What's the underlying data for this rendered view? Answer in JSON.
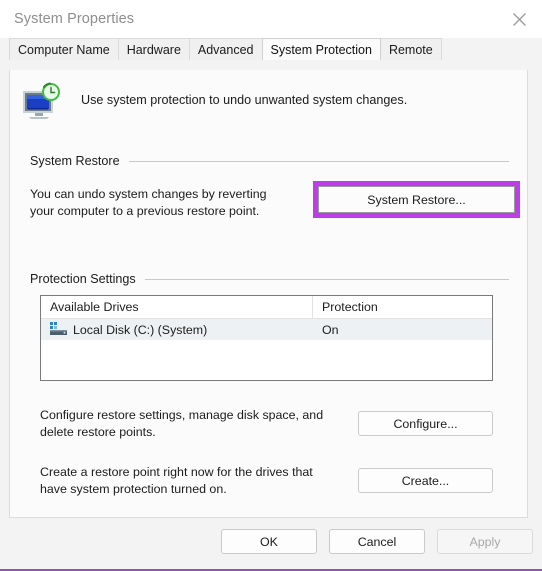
{
  "window": {
    "title": "System Properties",
    "close_icon": "close-icon"
  },
  "tabs": [
    {
      "label": "Computer Name",
      "active": false
    },
    {
      "label": "Hardware",
      "active": false
    },
    {
      "label": "Advanced",
      "active": false
    },
    {
      "label": "System Protection",
      "active": true
    },
    {
      "label": "Remote",
      "active": false
    }
  ],
  "panel": {
    "icon": "system-protection-icon",
    "headline": "Use system protection to undo unwanted system changes."
  },
  "system_restore": {
    "group_label": "System Restore",
    "description_line1": "You can undo system changes by reverting",
    "description_line2": "your computer to a previous restore point.",
    "button_label": "System Restore...",
    "highlight_color": "#bb3ee8"
  },
  "protection_settings": {
    "group_label": "Protection Settings",
    "columns": [
      "Available Drives",
      "Protection"
    ],
    "rows": [
      {
        "icon": "hard-drive-icon",
        "drive": "Local Disk (C:) (System)",
        "protection": "On"
      }
    ],
    "configure": {
      "description_line1": "Configure restore settings, manage disk space, and",
      "description_line2": "delete restore points.",
      "button_label": "Configure..."
    },
    "create": {
      "description_line1": "Create a restore point right now for the drives that",
      "description_line2": "have system protection turned on.",
      "button_label": "Create..."
    }
  },
  "footer": {
    "ok_label": "OK",
    "cancel_label": "Cancel",
    "apply_label": "Apply",
    "apply_disabled": true
  }
}
